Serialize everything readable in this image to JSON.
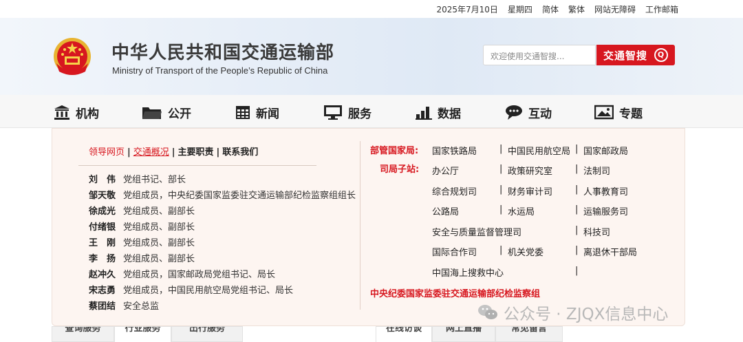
{
  "topbar": {
    "date": "2025年7月10日",
    "weekday": "星期四",
    "simplified": "简体",
    "traditional": "繁体",
    "accessibility": "网站无障碍",
    "mail": "工作邮箱"
  },
  "header": {
    "title_cn": "中华人民共和国交通运输部",
    "title_en": "Ministry of Transport of the People’s Republic of China",
    "search_placeholder": "欢迎使用交通智搜...",
    "search_button": "交通智搜"
  },
  "nav": {
    "items": [
      {
        "label": "机构",
        "icon": "building-icon"
      },
      {
        "label": "公开",
        "icon": "folder-icon"
      },
      {
        "label": "新闻",
        "icon": "calendar-grid-icon"
      },
      {
        "label": "服务",
        "icon": "monitor-icon"
      },
      {
        "label": "数据",
        "icon": "bar-chart-icon"
      },
      {
        "label": "互动",
        "icon": "chat-bubble-icon"
      },
      {
        "label": "专题",
        "icon": "picture-icon"
      }
    ]
  },
  "dropdown": {
    "tabs": [
      "领导网页",
      "交通概况",
      "主要职责",
      "联系我们"
    ],
    "leaders": [
      {
        "name": "刘　伟",
        "position": "党组书记、部长"
      },
      {
        "name": "邹天敬",
        "position": "党组成员，中央纪委国家监委驻交通运输部纪检监察组组长"
      },
      {
        "name": "徐成光",
        "position": "党组成员、副部长"
      },
      {
        "name": "付绪银",
        "position": "党组成员、副部长"
      },
      {
        "name": "王　刚",
        "position": "党组成员、副部长"
      },
      {
        "name": "李　扬",
        "position": "党组成员、副部长"
      },
      {
        "name": "赵冲久",
        "position": "党组成员，国家邮政局党组书记、局长"
      },
      {
        "name": "宋志勇",
        "position": "党组成员，中国民用航空局党组书记、局长"
      },
      {
        "name": "蔡团结",
        "position": "安全总监"
      }
    ],
    "national_bureaus_label": "部管国家局:",
    "national_bureaus": [
      "国家铁路局",
      "中国民用航空局",
      "国家邮政局"
    ],
    "departments_label": "司局子站:",
    "departments": [
      [
        "办公厅",
        "政策研究室",
        "法制司"
      ],
      [
        "综合规划司",
        "财务审计司",
        "人事教育司"
      ],
      [
        "公路局",
        "水运局",
        "运输服务司"
      ],
      [
        "安全与质量监督管理司",
        "科技司"
      ],
      [
        "国际合作司",
        "机关党委",
        "离退休干部局"
      ],
      [
        "中国海上搜救中心"
      ]
    ],
    "discipline_group": "中央纪委国家监委驻交通运输部纪检监察组"
  },
  "bottom_tabs": [
    "查询服务",
    "行业服务",
    "出行服务",
    "在线访谈",
    "网上直播",
    "常见留言"
  ],
  "watermark": "公众号 · ZJQX信息中心",
  "colors": {
    "accent": "#d7171f",
    "panel_bg": "#fdf5f1"
  }
}
